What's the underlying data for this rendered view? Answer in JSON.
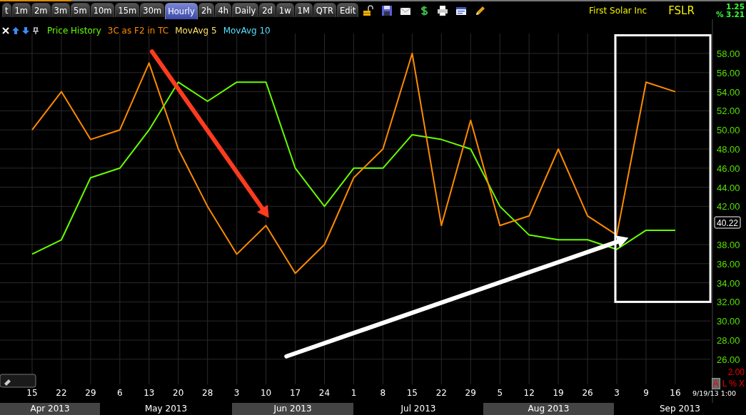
{
  "toolbar": {
    "tabs": [
      {
        "label": "t",
        "selected": false
      },
      {
        "label": "1m",
        "selected": false
      },
      {
        "label": "2m",
        "selected": false
      },
      {
        "label": "3m",
        "selected": false
      },
      {
        "label": "5m",
        "selected": false
      },
      {
        "label": "10m",
        "selected": false
      },
      {
        "label": "15m",
        "selected": false
      },
      {
        "label": "30m",
        "selected": false
      },
      {
        "label": "Hourly",
        "selected": true
      },
      {
        "label": "2h",
        "selected": false
      },
      {
        "label": "4h",
        "selected": false
      },
      {
        "label": "Daily",
        "selected": false
      },
      {
        "label": "2d",
        "selected": false
      },
      {
        "label": "1w",
        "selected": false
      },
      {
        "label": "1M",
        "selected": false
      },
      {
        "label": "QTR",
        "selected": false
      },
      {
        "label": "Edit",
        "selected": false
      }
    ],
    "icons": [
      {
        "kind": "lock"
      },
      {
        "kind": "save"
      },
      {
        "kind": "mail"
      },
      {
        "kind": "dollar"
      },
      {
        "kind": "print"
      },
      {
        "kind": "window"
      },
      {
        "kind": "pencil"
      }
    ]
  },
  "header": {
    "company": "First Solar Inc",
    "symbol": "FSLR",
    "change": "1.25",
    "percent_change": "% 3.21"
  },
  "legend": [
    {
      "label": "MovAvg 5",
      "color": "#ffe066"
    },
    {
      "label": "MovAvg 10",
      "color": "#55e0ff"
    }
  ],
  "chart_data": {
    "type": "line",
    "categories": [
      "15",
      "22",
      "29",
      "6",
      "13",
      "20",
      "28",
      "3",
      "10",
      "17",
      "24",
      "1",
      "8",
      "15",
      "22",
      "29",
      "5",
      "12",
      "19",
      "26",
      "3",
      "9",
      "16"
    ],
    "ylim": [
      21.43,
      61.58
    ],
    "grid": true,
    "yticks": [
      {
        "value": 26,
        "label": "26.00"
      },
      {
        "value": 28,
        "label": "28.00"
      },
      {
        "value": 30,
        "label": "30.00"
      },
      {
        "value": 32,
        "label": "32.00"
      },
      {
        "value": 34,
        "label": "34.00"
      },
      {
        "value": 36,
        "label": "36.00"
      },
      {
        "value": 38,
        "label": "38.00"
      },
      {
        "value": 42,
        "label": "42.00"
      },
      {
        "value": 44,
        "label": "44.00"
      },
      {
        "value": 46,
        "label": "46.00"
      },
      {
        "value": 48,
        "label": "48.00"
      },
      {
        "value": 50,
        "label": "50.00"
      },
      {
        "value": 52,
        "label": "52.00"
      },
      {
        "value": 54,
        "label": "54.00"
      },
      {
        "value": 56,
        "label": "56.00"
      },
      {
        "value": 58,
        "label": "58.00"
      }
    ],
    "series": [
      {
        "name": "Price History",
        "color": "#66ff00",
        "values": [
          37,
          38.5,
          45,
          46,
          50,
          55,
          53,
          55,
          55,
          46,
          42,
          46,
          46,
          49.5,
          49,
          48,
          42,
          39,
          38.5,
          38.5,
          37.5,
          39.5,
          39.5
        ]
      },
      {
        "name": "3C as F2 in TC",
        "color": "#ff8a00",
        "values": [
          50,
          54,
          49,
          50,
          57,
          48,
          42,
          37,
          40,
          35,
          38,
          45,
          48,
          58,
          40,
          51,
          40,
          41,
          48,
          41,
          39,
          55,
          54
        ]
      }
    ]
  },
  "last_price": "40.22",
  "scale_value": "2.00",
  "scale_buttons": [
    "A",
    "L",
    "%",
    "X"
  ],
  "timestamp": "9/19/13 1:00",
  "months": [
    {
      "label": "Apr 2013",
      "shaded": true
    },
    {
      "label": "May 2013",
      "shaded": false
    },
    {
      "label": "Jun 2013",
      "shaded": true
    },
    {
      "label": "Jul 2013",
      "shaded": false
    },
    {
      "label": "Aug 2013",
      "shaded": true
    },
    {
      "label": "Sep 2013",
      "shaded": false
    }
  ]
}
